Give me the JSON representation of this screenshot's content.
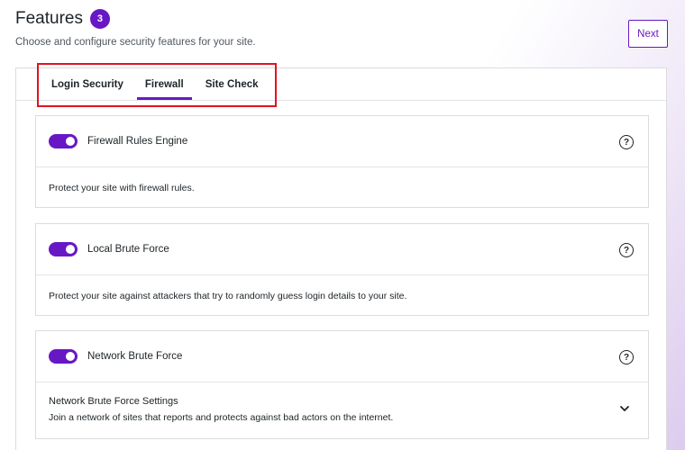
{
  "header": {
    "title": "Features",
    "badge_count": "3",
    "subtitle": "Choose and configure security features for your site."
  },
  "next_label": "Next",
  "tabs": [
    {
      "label": "Login Security",
      "active": false
    },
    {
      "label": "Firewall",
      "active": true
    },
    {
      "label": "Site Check",
      "active": false
    }
  ],
  "features": [
    {
      "title": "Firewall Rules Engine",
      "enabled": true,
      "description": "Protect your site with firewall rules."
    },
    {
      "title": "Local Brute Force",
      "enabled": true,
      "description": "Protect your site against attackers that try to randomly guess login details to your site."
    },
    {
      "title": "Network Brute Force",
      "enabled": true,
      "settings_title": "Network Brute Force Settings",
      "settings_description": "Join a network of sites that reports and protects against bad actors on the internet."
    }
  ],
  "help_glyph": "?",
  "colors": {
    "accent": "#6817c5",
    "highlight": "#e0141e"
  }
}
